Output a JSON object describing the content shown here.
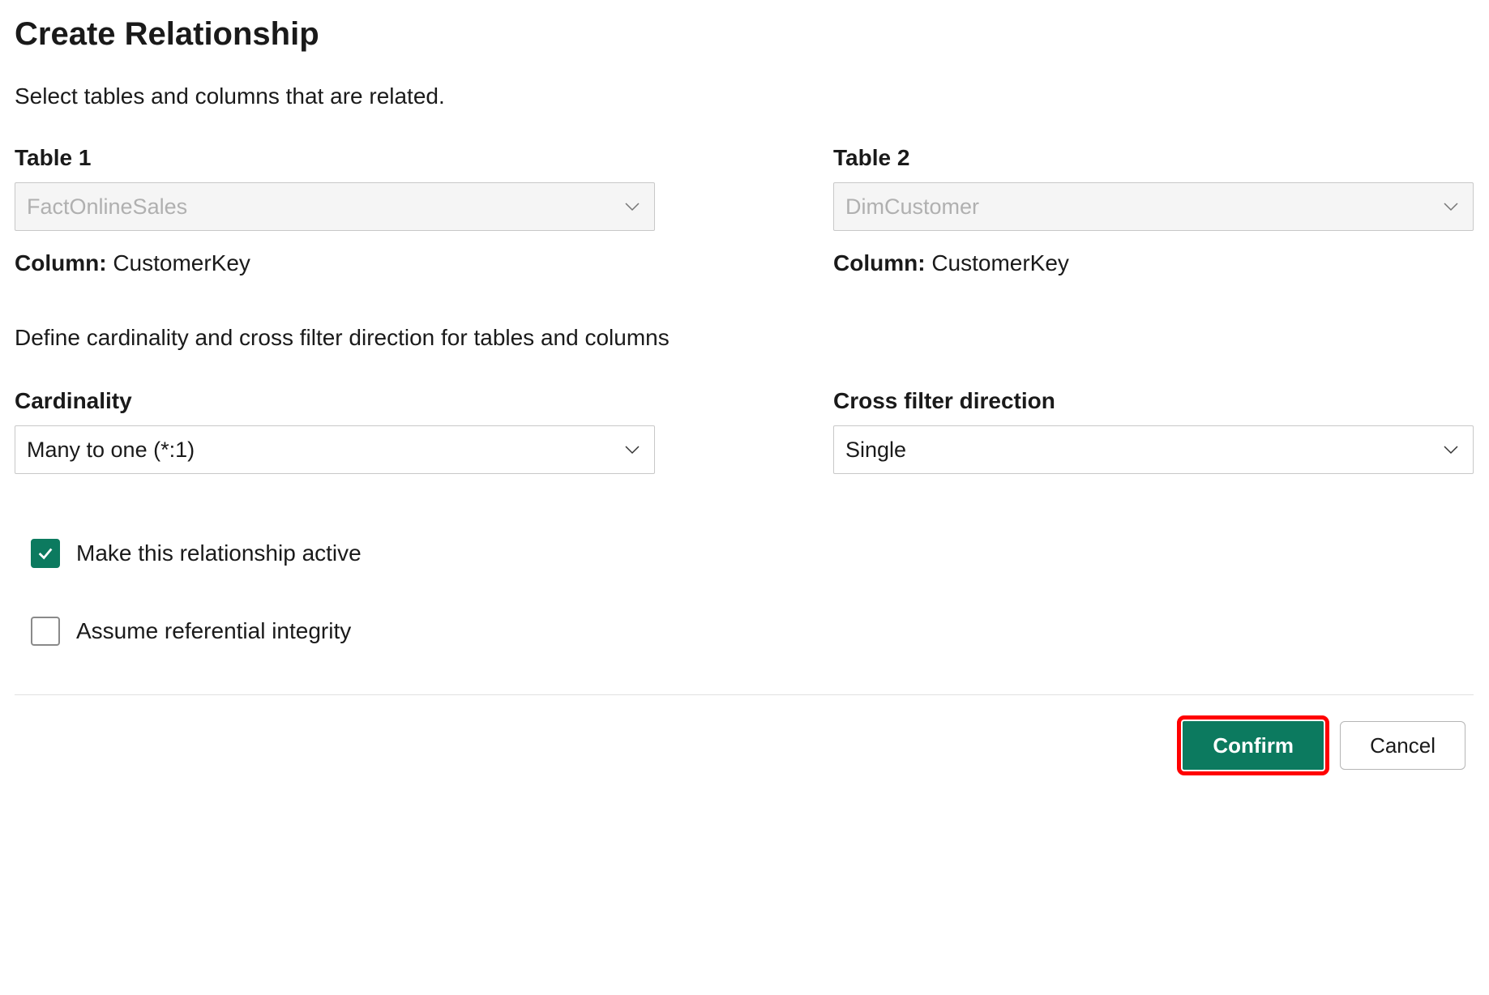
{
  "dialog": {
    "title": "Create Relationship",
    "subtitle": "Select tables and columns that are related.",
    "section2_subtitle": "Define cardinality and cross filter direction for tables and columns"
  },
  "table1": {
    "label": "Table 1",
    "selected": "FactOnlineSales",
    "column_prefix": "Column: ",
    "column_value": "CustomerKey"
  },
  "table2": {
    "label": "Table 2",
    "selected": "DimCustomer",
    "column_prefix": "Column: ",
    "column_value": "CustomerKey"
  },
  "cardinality": {
    "label": "Cardinality",
    "selected": "Many to one (*:1)"
  },
  "cross_filter": {
    "label": "Cross filter direction",
    "selected": "Single"
  },
  "checkboxes": {
    "active_label": "Make this relationship active",
    "integrity_label": "Assume referential integrity"
  },
  "buttons": {
    "confirm": "Confirm",
    "cancel": "Cancel"
  }
}
